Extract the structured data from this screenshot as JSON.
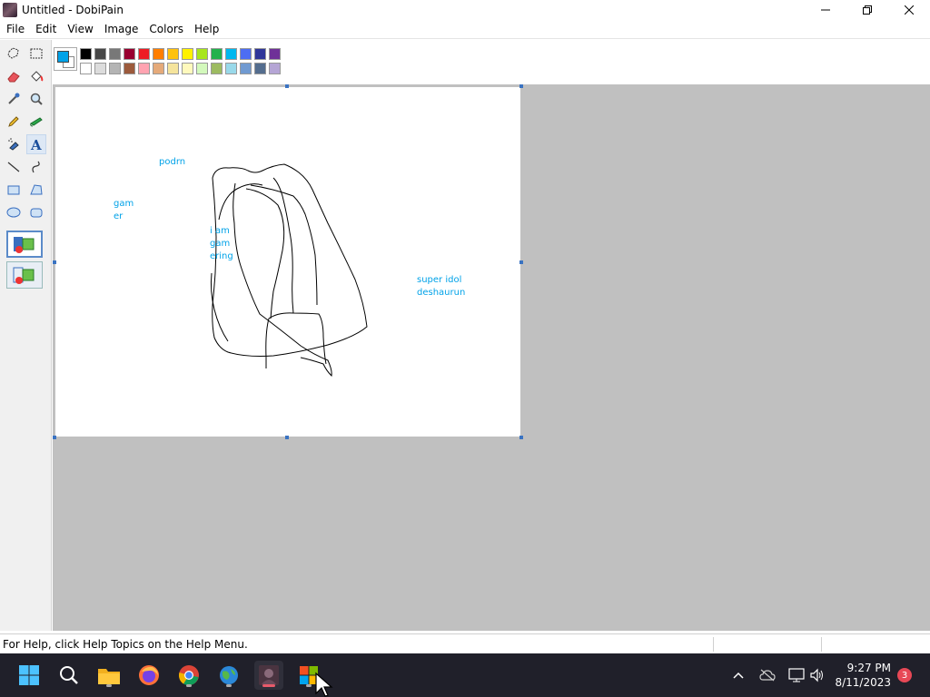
{
  "window": {
    "title": "Untitled - DobiPain"
  },
  "menu": {
    "items": [
      "File",
      "Edit",
      "View",
      "Image",
      "Colors",
      "Help"
    ]
  },
  "tools": [
    {
      "name": "free-select",
      "icon": "free-form-select-icon"
    },
    {
      "name": "rect-select",
      "icon": "rect-select-icon"
    },
    {
      "name": "eraser",
      "icon": "eraser-icon"
    },
    {
      "name": "fill",
      "icon": "fill-bucket-icon"
    },
    {
      "name": "picker",
      "icon": "color-picker-icon"
    },
    {
      "name": "magnifier",
      "icon": "magnifier-icon"
    },
    {
      "name": "pencil",
      "icon": "pencil-icon"
    },
    {
      "name": "brush",
      "icon": "brush-icon"
    },
    {
      "name": "airbrush",
      "icon": "airbrush-icon"
    },
    {
      "name": "text",
      "icon": "text-icon",
      "active": true
    },
    {
      "name": "line",
      "icon": "line-icon"
    },
    {
      "name": "curve",
      "icon": "curve-icon"
    },
    {
      "name": "rectangle",
      "icon": "rectangle-icon"
    },
    {
      "name": "polygon",
      "icon": "polygon-icon"
    },
    {
      "name": "ellipse",
      "icon": "ellipse-icon"
    },
    {
      "name": "rounded-rect",
      "icon": "rounded-rect-icon"
    }
  ],
  "palette": {
    "foreground": "#00a2e8",
    "background": "#ffffff",
    "row1": [
      "#000000",
      "#464646",
      "#787878",
      "#990030",
      "#ed1c24",
      "#ff7e00",
      "#ffc20e",
      "#fff200",
      "#a8e61d",
      "#22b14c",
      "#00b7ef",
      "#4d6df3",
      "#2f3699",
      "#6f3198"
    ],
    "row2": [
      "#ffffff",
      "#dcdcdc",
      "#b4b4b4",
      "#9c5a3c",
      "#ffa3b1",
      "#e5aa7a",
      "#f5e49c",
      "#fff9bd",
      "#d3f9bc",
      "#9dbb61",
      "#99d9ea",
      "#709ad1",
      "#546d8e",
      "#b5a5d5"
    ]
  },
  "canvas": {
    "texts": [
      {
        "text": "podrn"
      },
      {
        "text": "gam\ner"
      },
      {
        "text": "i am\ngam\nering"
      },
      {
        "text": "super idol\ndeshaurun"
      }
    ]
  },
  "status": {
    "text": "For Help, click Help Topics on the Help Menu."
  },
  "taskbar": {
    "time": "9:27 PM",
    "date": "8/11/2023",
    "notification_count": "3"
  }
}
